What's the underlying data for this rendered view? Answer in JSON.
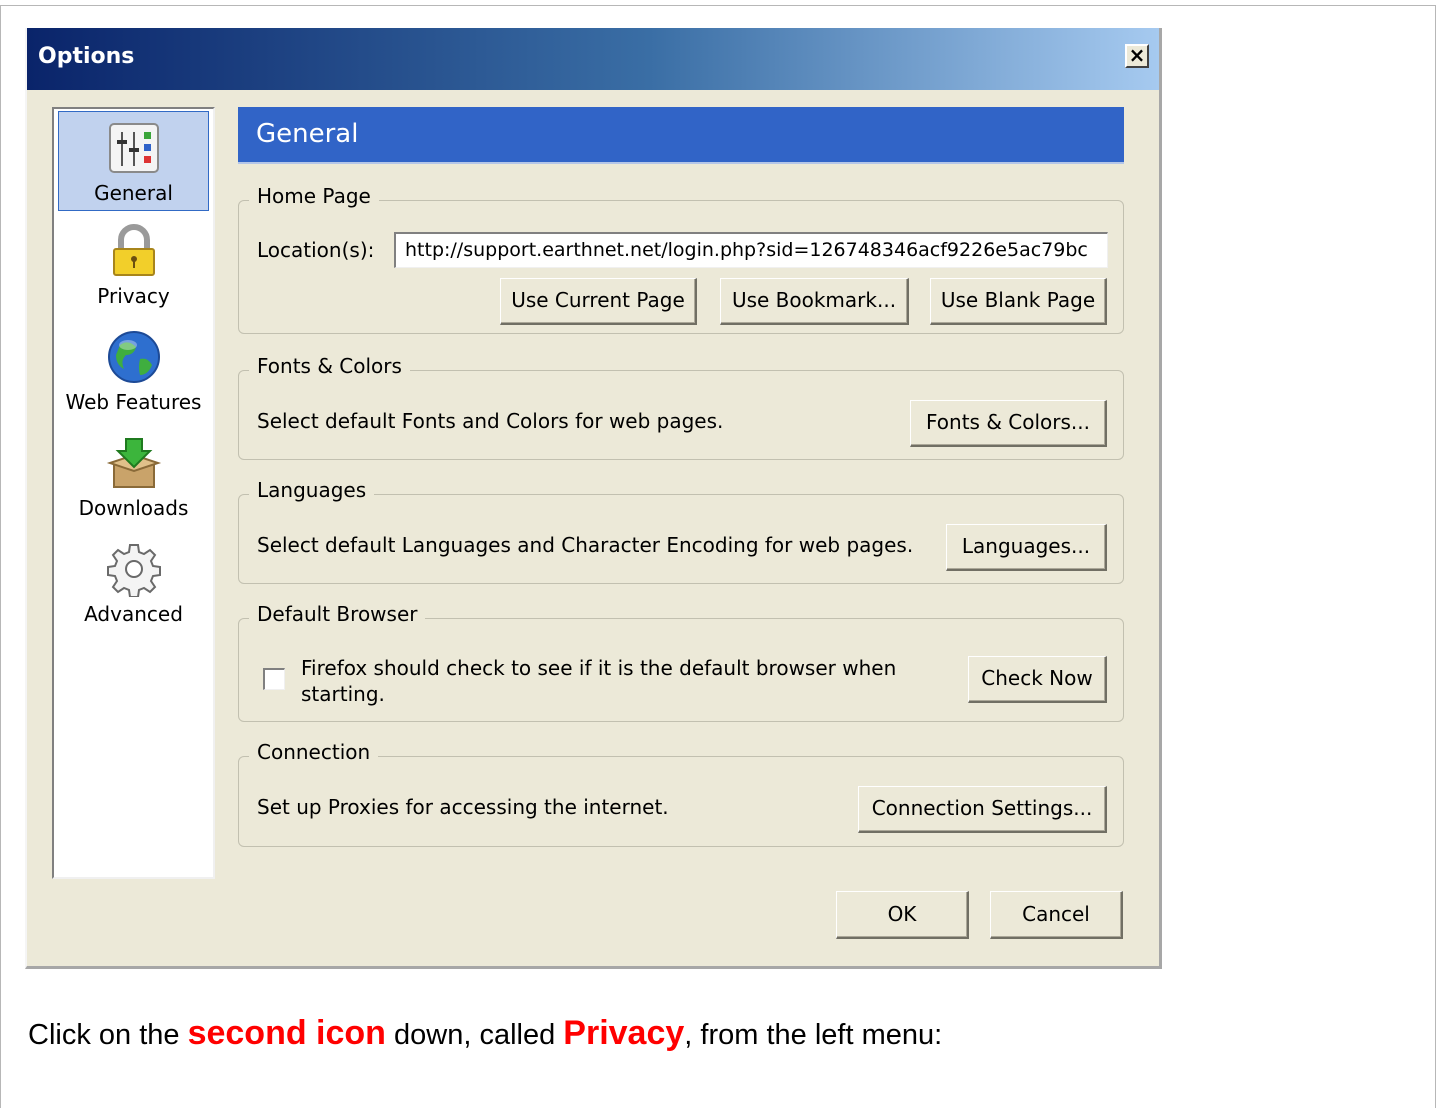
{
  "dialog": {
    "title": "Options",
    "close_glyph": "✕"
  },
  "sidebar": {
    "items": [
      {
        "label": "General",
        "icon": "sliders-icon",
        "selected": true
      },
      {
        "label": "Privacy",
        "icon": "padlock-icon",
        "selected": false
      },
      {
        "label": "Web Features",
        "icon": "globe-icon",
        "selected": false
      },
      {
        "label": "Downloads",
        "icon": "download-box-icon",
        "selected": false
      },
      {
        "label": "Advanced",
        "icon": "gear-icon",
        "selected": false
      }
    ]
  },
  "header": {
    "title": "General"
  },
  "home_page": {
    "legend": "Home Page",
    "location_label": "Location(s):",
    "location_value": "http://support.earthnet.net/login.php?sid=126748346acf9226e5ac79bc",
    "use_current_label": "Use Current Page",
    "use_bookmark_label": "Use Bookmark...",
    "use_blank_label": "Use Blank Page"
  },
  "fonts_colors": {
    "legend": "Fonts & Colors",
    "description": "Select default Fonts and Colors for web pages.",
    "button_label": "Fonts & Colors..."
  },
  "languages": {
    "legend": "Languages",
    "description": "Select default Languages and Character Encoding for web pages.",
    "button_label": "Languages..."
  },
  "default_browser": {
    "legend": "Default Browser",
    "checkbox_label": "Firefox should check to see if it is the default browser when starting.",
    "checked": false,
    "button_label": "Check Now"
  },
  "connection": {
    "legend": "Connection",
    "description": "Set up Proxies for accessing the internet.",
    "button_label": "Connection Settings..."
  },
  "footer": {
    "ok_label": "OK",
    "cancel_label": "Cancel"
  },
  "caption": {
    "part1": "Click on the ",
    "emph1": "second icon",
    "part2": " down, called ",
    "emph2": "Privacy",
    "part3": ", from the left menu:"
  },
  "colors": {
    "title_gradient_start": "#0a246a",
    "header_blue": "#3164c7",
    "dialog_bg": "#ece9d8",
    "caption_accent": "#ff0000"
  }
}
